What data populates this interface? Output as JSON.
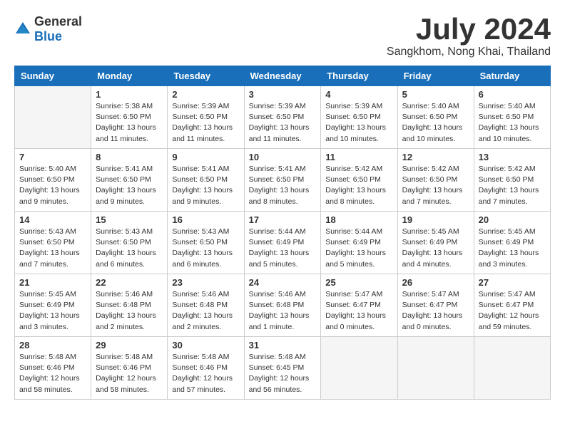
{
  "logo": {
    "general": "General",
    "blue": "Blue"
  },
  "title": "July 2024",
  "location": "Sangkhom, Nong Khai, Thailand",
  "days_of_week": [
    "Sunday",
    "Monday",
    "Tuesday",
    "Wednesday",
    "Thursday",
    "Friday",
    "Saturday"
  ],
  "weeks": [
    [
      {
        "day": "",
        "info": ""
      },
      {
        "day": "1",
        "info": "Sunrise: 5:38 AM\nSunset: 6:50 PM\nDaylight: 13 hours\nand 11 minutes."
      },
      {
        "day": "2",
        "info": "Sunrise: 5:39 AM\nSunset: 6:50 PM\nDaylight: 13 hours\nand 11 minutes."
      },
      {
        "day": "3",
        "info": "Sunrise: 5:39 AM\nSunset: 6:50 PM\nDaylight: 13 hours\nand 11 minutes."
      },
      {
        "day": "4",
        "info": "Sunrise: 5:39 AM\nSunset: 6:50 PM\nDaylight: 13 hours\nand 10 minutes."
      },
      {
        "day": "5",
        "info": "Sunrise: 5:40 AM\nSunset: 6:50 PM\nDaylight: 13 hours\nand 10 minutes."
      },
      {
        "day": "6",
        "info": "Sunrise: 5:40 AM\nSunset: 6:50 PM\nDaylight: 13 hours\nand 10 minutes."
      }
    ],
    [
      {
        "day": "7",
        "info": "Sunrise: 5:40 AM\nSunset: 6:50 PM\nDaylight: 13 hours\nand 9 minutes."
      },
      {
        "day": "8",
        "info": "Sunrise: 5:41 AM\nSunset: 6:50 PM\nDaylight: 13 hours\nand 9 minutes."
      },
      {
        "day": "9",
        "info": "Sunrise: 5:41 AM\nSunset: 6:50 PM\nDaylight: 13 hours\nand 9 minutes."
      },
      {
        "day": "10",
        "info": "Sunrise: 5:41 AM\nSunset: 6:50 PM\nDaylight: 13 hours\nand 8 minutes."
      },
      {
        "day": "11",
        "info": "Sunrise: 5:42 AM\nSunset: 6:50 PM\nDaylight: 13 hours\nand 8 minutes."
      },
      {
        "day": "12",
        "info": "Sunrise: 5:42 AM\nSunset: 6:50 PM\nDaylight: 13 hours\nand 7 minutes."
      },
      {
        "day": "13",
        "info": "Sunrise: 5:42 AM\nSunset: 6:50 PM\nDaylight: 13 hours\nand 7 minutes."
      }
    ],
    [
      {
        "day": "14",
        "info": "Sunrise: 5:43 AM\nSunset: 6:50 PM\nDaylight: 13 hours\nand 7 minutes."
      },
      {
        "day": "15",
        "info": "Sunrise: 5:43 AM\nSunset: 6:50 PM\nDaylight: 13 hours\nand 6 minutes."
      },
      {
        "day": "16",
        "info": "Sunrise: 5:43 AM\nSunset: 6:50 PM\nDaylight: 13 hours\nand 6 minutes."
      },
      {
        "day": "17",
        "info": "Sunrise: 5:44 AM\nSunset: 6:49 PM\nDaylight: 13 hours\nand 5 minutes."
      },
      {
        "day": "18",
        "info": "Sunrise: 5:44 AM\nSunset: 6:49 PM\nDaylight: 13 hours\nand 5 minutes."
      },
      {
        "day": "19",
        "info": "Sunrise: 5:45 AM\nSunset: 6:49 PM\nDaylight: 13 hours\nand 4 minutes."
      },
      {
        "day": "20",
        "info": "Sunrise: 5:45 AM\nSunset: 6:49 PM\nDaylight: 13 hours\nand 3 minutes."
      }
    ],
    [
      {
        "day": "21",
        "info": "Sunrise: 5:45 AM\nSunset: 6:49 PM\nDaylight: 13 hours\nand 3 minutes."
      },
      {
        "day": "22",
        "info": "Sunrise: 5:46 AM\nSunset: 6:48 PM\nDaylight: 13 hours\nand 2 minutes."
      },
      {
        "day": "23",
        "info": "Sunrise: 5:46 AM\nSunset: 6:48 PM\nDaylight: 13 hours\nand 2 minutes."
      },
      {
        "day": "24",
        "info": "Sunrise: 5:46 AM\nSunset: 6:48 PM\nDaylight: 13 hours\nand 1 minute."
      },
      {
        "day": "25",
        "info": "Sunrise: 5:47 AM\nSunset: 6:47 PM\nDaylight: 13 hours\nand 0 minutes."
      },
      {
        "day": "26",
        "info": "Sunrise: 5:47 AM\nSunset: 6:47 PM\nDaylight: 13 hours\nand 0 minutes."
      },
      {
        "day": "27",
        "info": "Sunrise: 5:47 AM\nSunset: 6:47 PM\nDaylight: 12 hours\nand 59 minutes."
      }
    ],
    [
      {
        "day": "28",
        "info": "Sunrise: 5:48 AM\nSunset: 6:46 PM\nDaylight: 12 hours\nand 58 minutes."
      },
      {
        "day": "29",
        "info": "Sunrise: 5:48 AM\nSunset: 6:46 PM\nDaylight: 12 hours\nand 58 minutes."
      },
      {
        "day": "30",
        "info": "Sunrise: 5:48 AM\nSunset: 6:46 PM\nDaylight: 12 hours\nand 57 minutes."
      },
      {
        "day": "31",
        "info": "Sunrise: 5:48 AM\nSunset: 6:45 PM\nDaylight: 12 hours\nand 56 minutes."
      },
      {
        "day": "",
        "info": ""
      },
      {
        "day": "",
        "info": ""
      },
      {
        "day": "",
        "info": ""
      }
    ]
  ]
}
